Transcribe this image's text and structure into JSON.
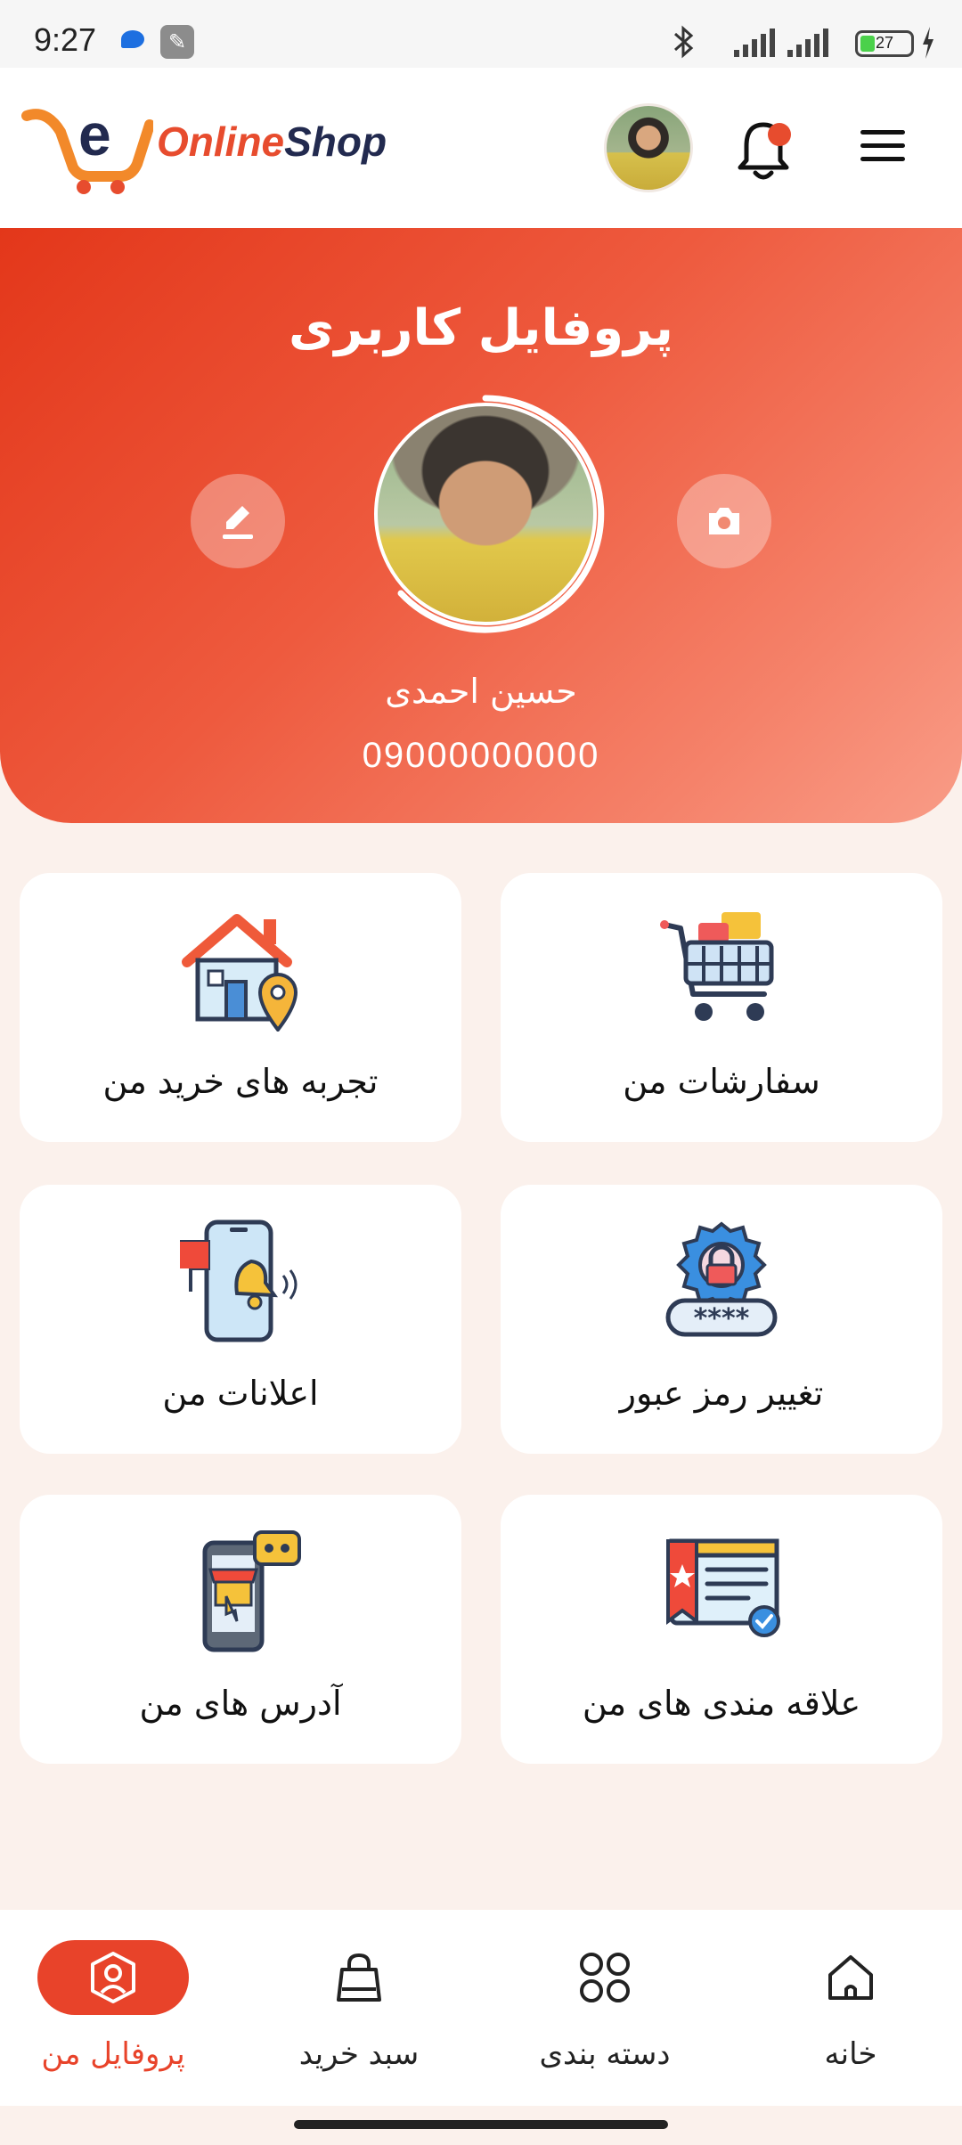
{
  "status_bar": {
    "time": "9:27",
    "battery": "27",
    "icons": [
      "chat-icon",
      "tool-icon",
      "bluetooth-icon",
      "signal-icon",
      "signal-icon",
      "battery-icon",
      "charging-icon"
    ]
  },
  "header": {
    "brand_part1": "Online",
    "brand_part2": "Shop",
    "logo_letter": "e",
    "icons": [
      "avatar",
      "bell-icon",
      "menu-icon"
    ],
    "notification_dot_color": "#e74c2e"
  },
  "profile": {
    "title": "پروفایل کاربری",
    "name": "حسین احمدی",
    "phone": "09000000000",
    "accent": "#e74c2e"
  },
  "menu_cards": [
    {
      "label": "سفارشات من",
      "icon": "shopping-cart-icon"
    },
    {
      "label": "تجربه های خرید من",
      "icon": "house-location-icon"
    },
    {
      "label": "تغییر رمز عبور",
      "icon": "password-lock-icon"
    },
    {
      "label": "اعلانات من",
      "icon": "phone-notification-icon"
    },
    {
      "label": "علاقه مندی های من",
      "icon": "favorite-list-icon"
    },
    {
      "label": "آدرس های من",
      "icon": "store-address-icon"
    }
  ],
  "bottom_nav": [
    {
      "label": "خانه",
      "icon": "home-icon"
    },
    {
      "label": "دسته بندی",
      "icon": "category-icon"
    },
    {
      "label": "سبد خرید",
      "icon": "shopping-bag-icon"
    },
    {
      "label": "پروفایل من",
      "icon": "profile-icon",
      "active": true
    }
  ]
}
